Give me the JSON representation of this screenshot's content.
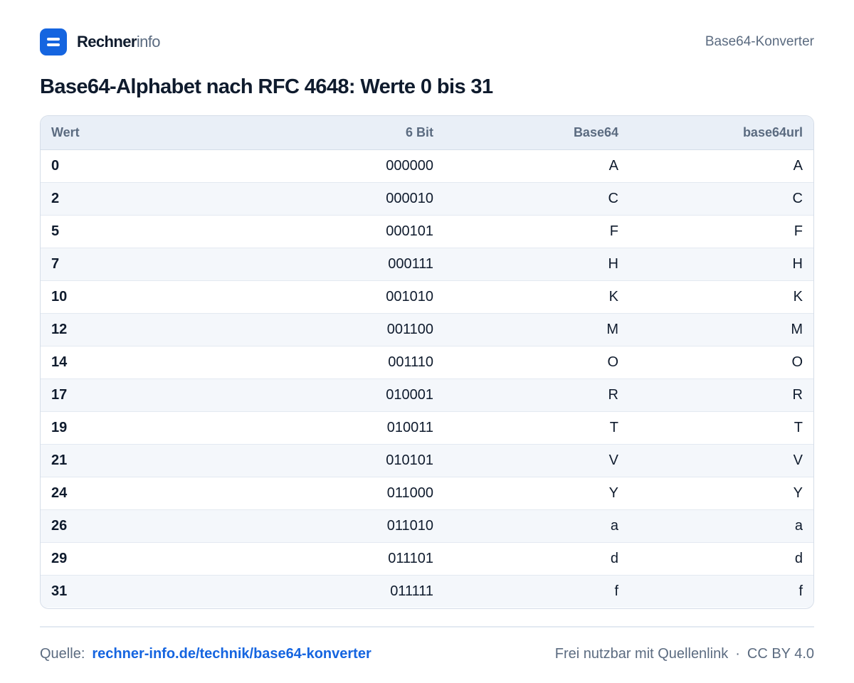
{
  "header": {
    "brand_strong": "Rechner",
    "brand_light": "info",
    "section": "Base64-Konverter"
  },
  "title": "Base64-Alphabet nach RFC 4648: Werte 0 bis 31",
  "table": {
    "columns": [
      "Wert",
      "6 Bit",
      "Base64",
      "base64url"
    ],
    "rows": [
      [
        "0",
        "000000",
        "A",
        "A"
      ],
      [
        "2",
        "000010",
        "C",
        "C"
      ],
      [
        "5",
        "000101",
        "F",
        "F"
      ],
      [
        "7",
        "000111",
        "H",
        "H"
      ],
      [
        "10",
        "001010",
        "K",
        "K"
      ],
      [
        "12",
        "001100",
        "M",
        "M"
      ],
      [
        "14",
        "001110",
        "O",
        "O"
      ],
      [
        "17",
        "010001",
        "R",
        "R"
      ],
      [
        "19",
        "010011",
        "T",
        "T"
      ],
      [
        "21",
        "010101",
        "V",
        "V"
      ],
      [
        "24",
        "011000",
        "Y",
        "Y"
      ],
      [
        "26",
        "011010",
        "a",
        "a"
      ],
      [
        "29",
        "011101",
        "d",
        "d"
      ],
      [
        "31",
        "011111",
        "f",
        "f"
      ]
    ]
  },
  "footer": {
    "source_label": "Quelle:",
    "source_link": "rechner-info.de/technik/base64-konverter",
    "license_text": "Frei nutzbar mit Quellenlink",
    "separator": "·",
    "license": "CC BY 4.0"
  },
  "colors": {
    "accent": "#1565e0",
    "header_bg": "#e9eff7",
    "row_alt": "#f4f7fb",
    "border": "#d5dde8"
  },
  "icons": {
    "logo": "menu-lines-icon"
  }
}
